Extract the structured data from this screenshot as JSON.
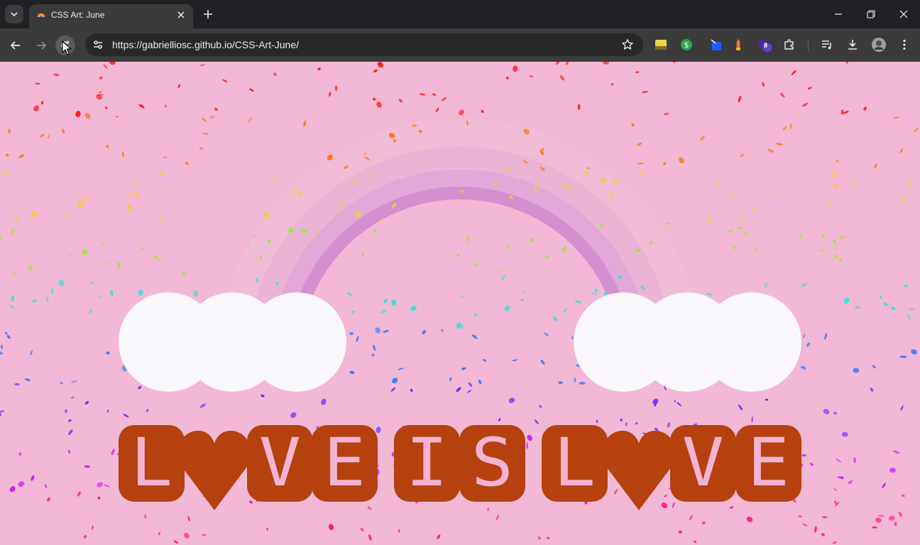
{
  "browser": {
    "tab": {
      "title": "CSS Art: June"
    },
    "address_bar": {
      "url": "https://gabrielliosc.github.io/CSS-Art-June/"
    },
    "extensions": {
      "badge_count": "8"
    }
  },
  "page": {
    "background": "#f3b8d5",
    "tile_color": "#b5410e",
    "letter_color": "#f4b3d3",
    "cloud_color": "#faf8fc",
    "rainbow_color": "#d48fcf",
    "words": [
      {
        "letters": [
          "L",
          "♥",
          "V",
          "E"
        ]
      },
      {
        "letters": [
          "I",
          "S"
        ]
      },
      {
        "letters": [
          "L",
          "♥",
          "V",
          "E"
        ]
      }
    ],
    "confetti_colors": [
      "#ff1a1a",
      "#ff7a1a",
      "#f5d020",
      "#8ff02a",
      "#2ae6d8",
      "#2a7cff",
      "#6a2aff",
      "#d21aff",
      "#ff1a8c"
    ]
  }
}
